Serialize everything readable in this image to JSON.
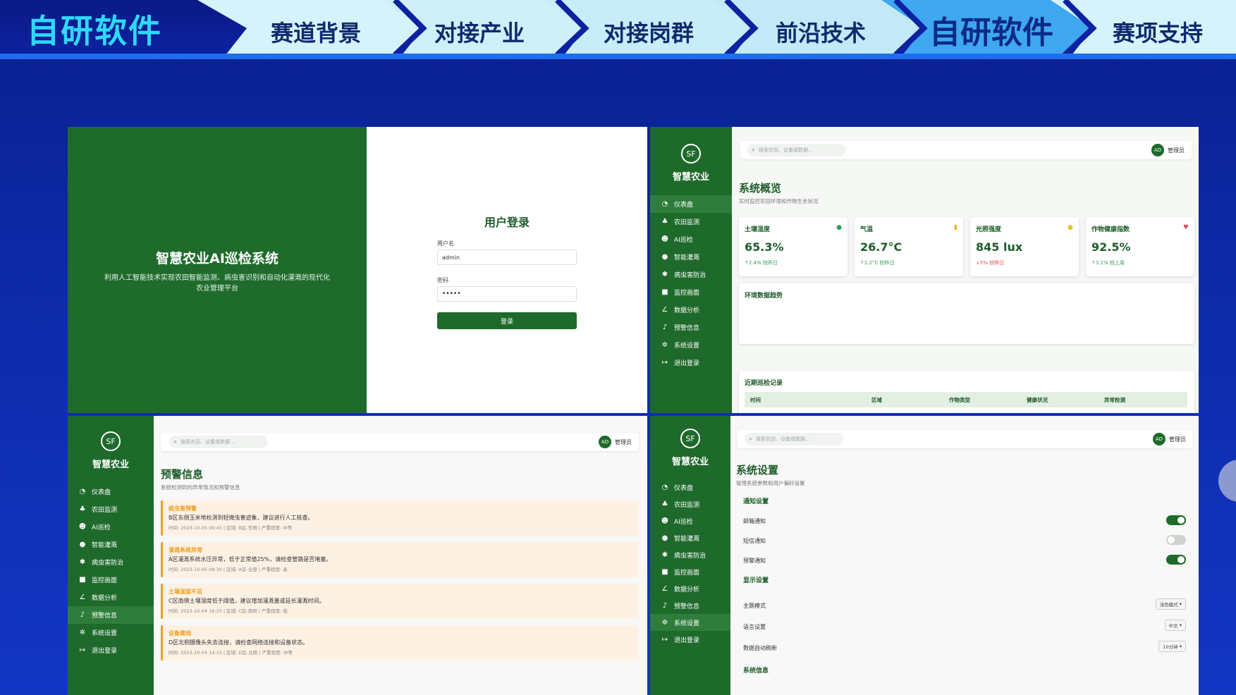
{
  "nav": {
    "brand": "自研软件",
    "tabs": [
      "赛道背景",
      "对接产业",
      "对接岗群",
      "前沿技术",
      "自研软件",
      "赛项支持"
    ]
  },
  "login": {
    "system_title": "智慧农业AI巡检系统",
    "system_desc": "利用人工智能技术实现农田智能监测、病虫害识别和自动化灌溉的现代化农业管理平台",
    "form_title": "用户登录",
    "username_label": "用户名",
    "username_value": "admin",
    "password_label": "密码",
    "password_value": "•••••",
    "login_button": "登录"
  },
  "app": {
    "logo": "SF",
    "name": "智慧农业",
    "search_placeholder": "搜索农田、设备或数据...",
    "avatar": "AD",
    "user": "管理员",
    "menu": [
      "仪表盘",
      "农田监测",
      "AI巡检",
      "智能灌溉",
      "病虫害防治",
      "监控画面",
      "数据分析",
      "预警信息",
      "系统设置",
      "退出登录"
    ]
  },
  "dashboard": {
    "title": "系统概览",
    "subtitle": "实时监控农田环境和作物生长状况",
    "cards": [
      {
        "label": "土壤湿度",
        "value": "65.3%",
        "change": "↑2.4% 较昨日",
        "color": "#2e9e4a",
        "icon": "droplet-icon"
      },
      {
        "label": "气温",
        "value": "26.7°C",
        "change": "↑1.2°C 较昨日",
        "color": "#2e9e4a",
        "icon": "thermometer-icon"
      },
      {
        "label": "光照强度",
        "value": "845 lux",
        "change": "↓5% 较昨日",
        "color": "#e34a4a",
        "icon": "sun-icon"
      },
      {
        "label": "作物健康指数",
        "value": "92.5%",
        "change": "↑3.1% 较上周",
        "color": "#2e9e4a",
        "icon": "heart-icon"
      }
    ],
    "trend_title": "环境数据趋势",
    "records_title": "近期巡检记录",
    "records_headers": [
      "时间",
      "区域",
      "作物类型",
      "健康状况",
      "异常检测"
    ]
  },
  "alerts": {
    "title": "预警信息",
    "subtitle": "系统检测到的异常情况和预警信息",
    "items": [
      {
        "title": "病虫害预警",
        "message": "B区东侧玉米地检测到轻微虫害迹象，建议进行人工核查。",
        "detail": "时间: 2023-10-05 09:45 | 区域: B区-东侧 | 严重程度: 中等"
      },
      {
        "title": "灌溉系统异常",
        "message": "A区灌溉系统水压异常，低于正常值25%，请检查管路是否堵塞。",
        "detail": "时间: 2023-10-05 08:30 | 区域: A区-全部 | 严重程度: 高"
      },
      {
        "title": "土壤湿度不足",
        "message": "C区南侧土壤湿度低于阈值，建议增加灌溉量或延长灌溉时间。",
        "detail": "时间: 2023-10-04 16:20 | 区域: C区-南侧 | 严重程度: 低"
      },
      {
        "title": "设备离线",
        "message": "D区北侧摄像头失去连接，请检查网络连接和设备状态。",
        "detail": "时间: 2023-10-04 14:15 | 区域: D区-北侧 | 严重程度: 中等"
      }
    ]
  },
  "settings": {
    "title": "系统设置",
    "subtitle": "管理系统参数和用户偏好设置",
    "notify_section": "通知设置",
    "toggles": [
      {
        "label": "邮箱通知",
        "on": true
      },
      {
        "label": "短信通知",
        "on": false
      },
      {
        "label": "预警通知",
        "on": true
      }
    ],
    "display_section": "显示设置",
    "selects": [
      {
        "label": "主题模式",
        "value": "浅色模式"
      },
      {
        "label": "语言设置",
        "value": "中文"
      },
      {
        "label": "数据自动刷新",
        "value": "10分钟"
      }
    ],
    "info_section": "系统信息"
  }
}
